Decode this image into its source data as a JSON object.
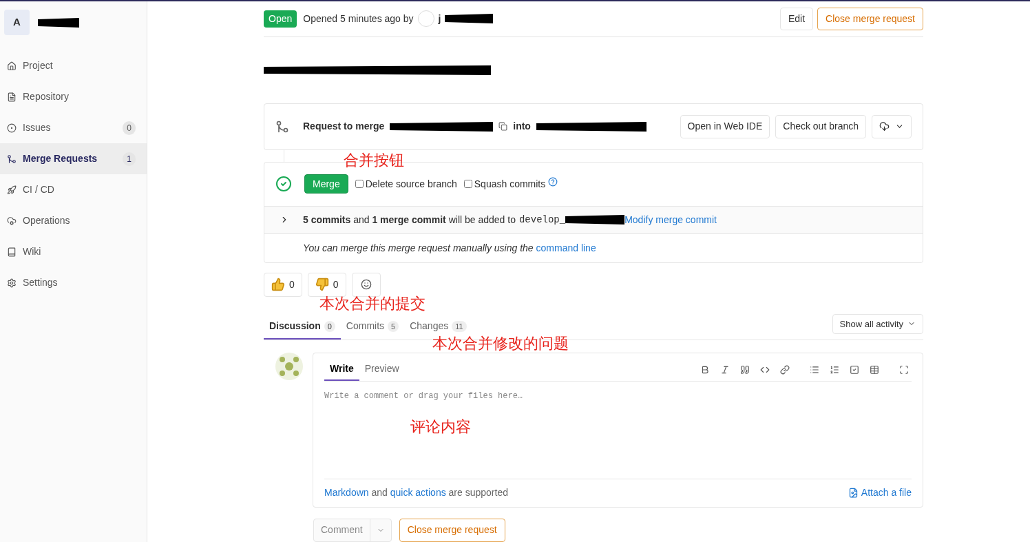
{
  "sidebar": {
    "avatar_letter": "A",
    "items": [
      {
        "kind": "project",
        "label": "Project",
        "selected": false
      },
      {
        "kind": "repository",
        "label": "Repository",
        "selected": false
      },
      {
        "kind": "issues",
        "label": "Issues",
        "count": "0",
        "selected": false
      },
      {
        "kind": "merge",
        "label": "Merge Requests",
        "count": "1",
        "selected": true
      },
      {
        "kind": "cicd",
        "label": "CI / CD",
        "selected": false
      },
      {
        "kind": "operations",
        "label": "Operations",
        "selected": false
      },
      {
        "kind": "wiki",
        "label": "Wiki",
        "selected": false
      },
      {
        "kind": "settings",
        "label": "Settings",
        "selected": false
      }
    ]
  },
  "header": {
    "status": "Open",
    "opened_text": "Opened 5 minutes ago by",
    "author": "j",
    "buttons": [
      "Edit",
      "Close merge request"
    ]
  },
  "merge_info": {
    "label": "Request to merge",
    "into": "into",
    "buttons": [
      "Open in Web IDE",
      "Check out branch"
    ]
  },
  "widget": {
    "merge_button": "Merge",
    "checkboxes": [
      {
        "label": "Delete source branch",
        "checked": false
      },
      {
        "label": "Squash commits",
        "checked": false
      }
    ],
    "commits_text": "**5 commits** and **1 merge commit** will be added to",
    "target_branch": "develop_",
    "modify_link": "Modify merge commit",
    "manual_text": "You can merge this merge request manually using the",
    "manual_link": "command line"
  },
  "reactions": [
    {
      "kind": "thumbs_up",
      "count": "0"
    },
    {
      "kind": "thumbs_down",
      "count": "0"
    }
  ],
  "tabs": [
    {
      "label": "Discussion",
      "count": "0",
      "selected": true
    },
    {
      "label": "Commits",
      "count": "5",
      "selected": false
    },
    {
      "label": "Changes",
      "count": "11",
      "selected": false
    }
  ],
  "activity_filter": "Show all activity",
  "editor": {
    "tabs": [
      {
        "label": "Write",
        "selected": true
      },
      {
        "label": "Preview",
        "selected": false
      }
    ],
    "placeholder": "Write a comment or drag your files here…",
    "footer": {
      "markdown_link": "Markdown",
      "and": "and",
      "quick_actions_link": "quick actions",
      "supported": "are supported"
    },
    "attach": "Attach a file"
  },
  "actions": {
    "comment": "Comment",
    "close": "Close merge request"
  },
  "annotations": [
    "合并按钮",
    "本次合并的提交",
    "本次合并修改的问题",
    "评论内容"
  ]
}
